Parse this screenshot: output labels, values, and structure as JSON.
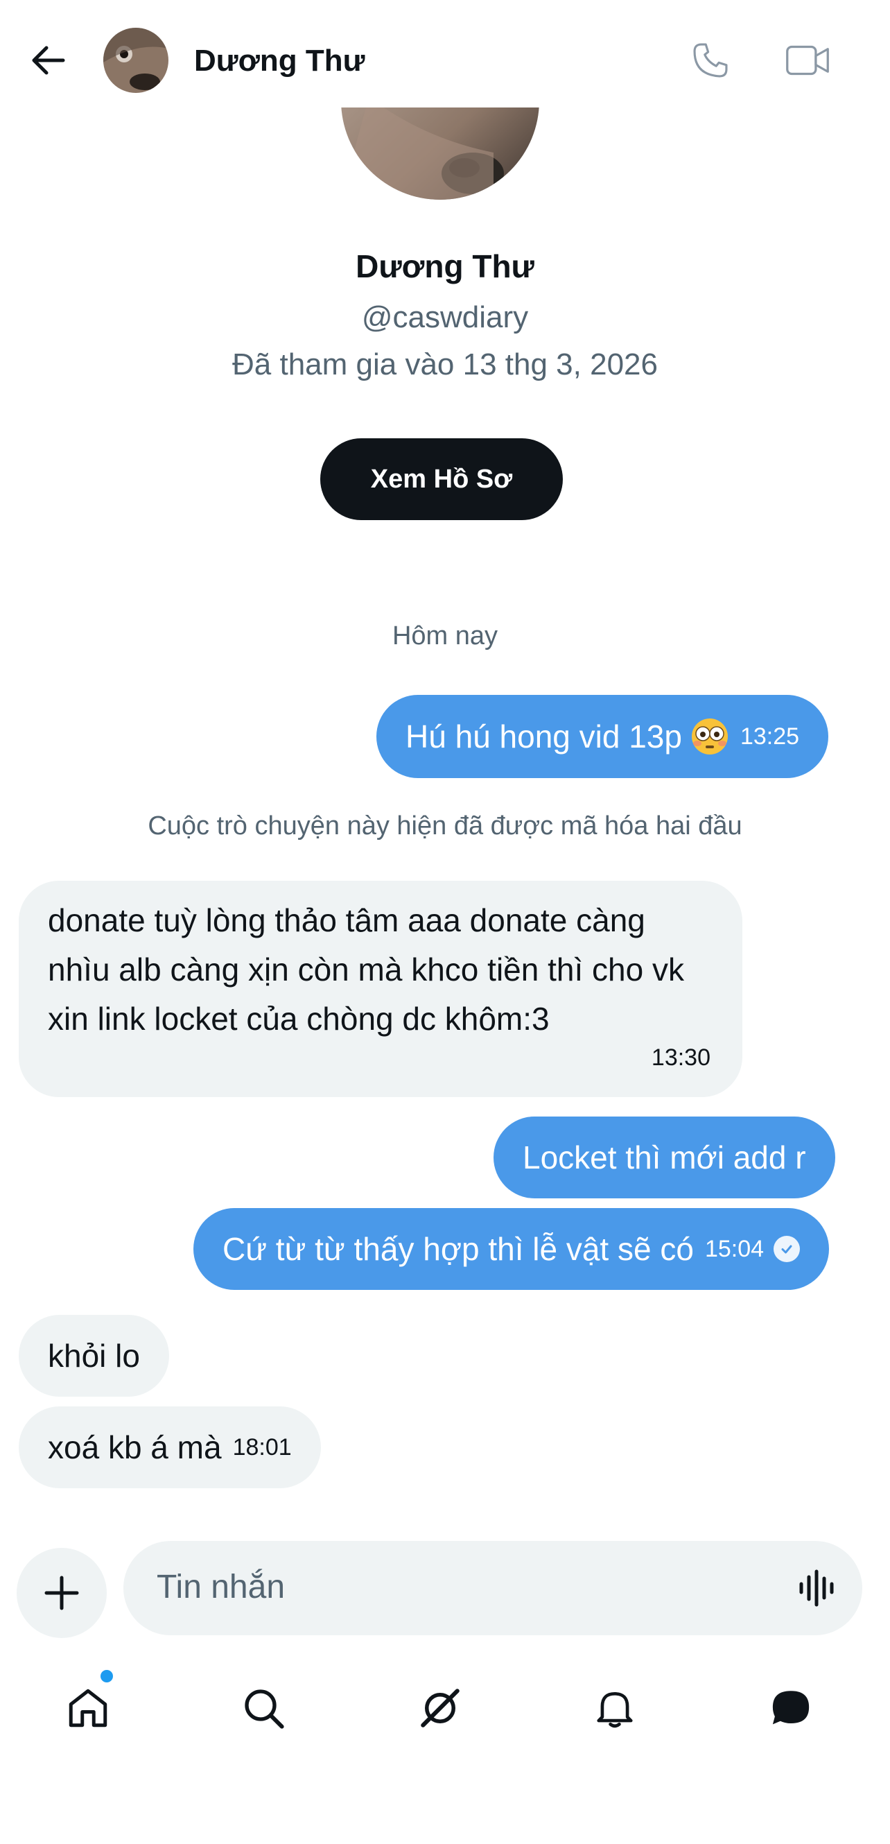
{
  "header": {
    "title": "Dương Thư",
    "back_icon": "arrow-left-icon",
    "call_icon": "phone-icon",
    "video_icon": "video-icon"
  },
  "profile": {
    "name": "Dương Thư",
    "handle": "@caswdiary",
    "joined": "Đã tham gia vào 13 thg 3, 2026",
    "view_button": "Xem Hồ Sơ"
  },
  "conversation": {
    "date_separator": "Hôm nay",
    "encryption_note": "Cuộc trò chuyện này hiện đã được mã hóa hai đầu",
    "messages": [
      {
        "dir": "out",
        "text": "Hú hú hong vid 13p",
        "emoji": "flushed-face",
        "time": "13:25"
      },
      {
        "dir": "in",
        "text": "donate tuỳ lòng thảo tâm aaa donate càng nhìu alb càng xịn còn mà khco tiền thì cho vk xin link locket của chòng dc khôm:3",
        "time": "13:30"
      },
      {
        "dir": "out",
        "text": "Locket thì mới add r",
        "time": ""
      },
      {
        "dir": "out",
        "text": "Cứ từ từ thấy hợp thì lễ vật sẽ có",
        "time": "15:04",
        "status": "seen"
      },
      {
        "dir": "in",
        "text": "khỏi lo",
        "time": ""
      },
      {
        "dir": "in",
        "text": "xoá kb á mà",
        "time": "18:01"
      }
    ]
  },
  "composer": {
    "placeholder": "Tin nhắn",
    "add_icon": "plus-icon",
    "voice_icon": "voice-waveform-icon"
  },
  "nav": {
    "items": [
      "home-icon",
      "search-icon",
      "grok-icon",
      "notifications-icon",
      "messages-icon"
    ],
    "accent_color": "#1d9bf0"
  },
  "colors": {
    "outgoing_bubble": "#4a99e9",
    "incoming_bubble": "#eff3f4",
    "button_dark": "#0f1419"
  }
}
